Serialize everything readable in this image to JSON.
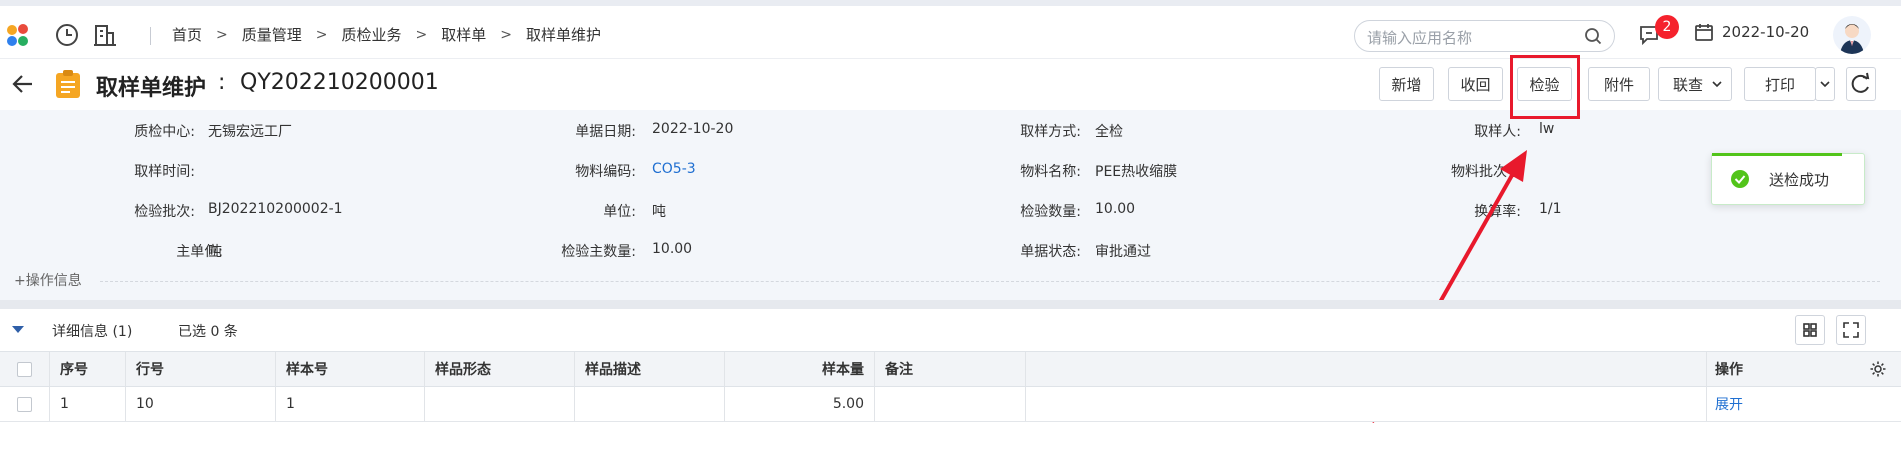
{
  "breadcrumb": [
    "首页",
    "质量管理",
    "质检业务",
    "取样单",
    "取样单维护"
  ],
  "search": {
    "placeholder": "请输入应用名称"
  },
  "notifications": {
    "count": "2"
  },
  "header_date": "2022-10-20",
  "page": {
    "title": "取样单维护",
    "separator": ":",
    "doc_no": "QY202210200001"
  },
  "toolbar": {
    "add": "新增",
    "recall": "收回",
    "inspect": "检验",
    "attachment": "附件",
    "link_query": "联查",
    "print": "打印"
  },
  "form": {
    "fields": [
      {
        "label": "质检中心:",
        "value": "无锡宏远工厂",
        "link": false
      },
      {
        "label": "单据日期:",
        "value": "2022-10-20",
        "link": false
      },
      {
        "label": "取样方式:",
        "value": "全检",
        "link": false
      },
      {
        "label": "取样人:",
        "value": "lw",
        "link": false
      },
      {
        "label": "取样时间:",
        "value": "",
        "link": false
      },
      {
        "label": "物料编码:",
        "value": "CO5-3",
        "link": true
      },
      {
        "label": "物料名称:",
        "value": "PEE热收缩膜",
        "link": false
      },
      {
        "label": "物料批次号",
        "value": "",
        "link": false
      },
      {
        "label": "检验批次:",
        "value": "BJ202210200002-1",
        "link": false
      },
      {
        "label": "单位:",
        "value": "吨",
        "link": false
      },
      {
        "label": "检验数量:",
        "value": "10.00",
        "link": false
      },
      {
        "label": "换算率:",
        "value": "1/1",
        "link": false
      },
      {
        "label": "主单位:",
        "value": "吨",
        "link": false
      },
      {
        "label": "检验主数量:",
        "value": "10.00",
        "link": false
      },
      {
        "label": "单据状态:",
        "value": "审批通过",
        "link": false
      }
    ],
    "operation_info": "+操作信息"
  },
  "toast": {
    "message": "送检成功",
    "color": "#52c41a"
  },
  "detail": {
    "title": "详细信息 (1)",
    "selected": "已选 0 条",
    "columns": [
      "序号",
      "行号",
      "样本号",
      "样品形态",
      "样品描述",
      "样本量",
      "备注",
      "操作"
    ],
    "rows": [
      {
        "seq": "1",
        "line": "10",
        "sample_no": "1",
        "form": "",
        "desc": "",
        "qty": "5.00",
        "remark": "",
        "action": "展开"
      }
    ]
  },
  "colors": {
    "accent": "#1f6fd1",
    "highlight": "#e8192c",
    "badge": "#f5222d"
  }
}
